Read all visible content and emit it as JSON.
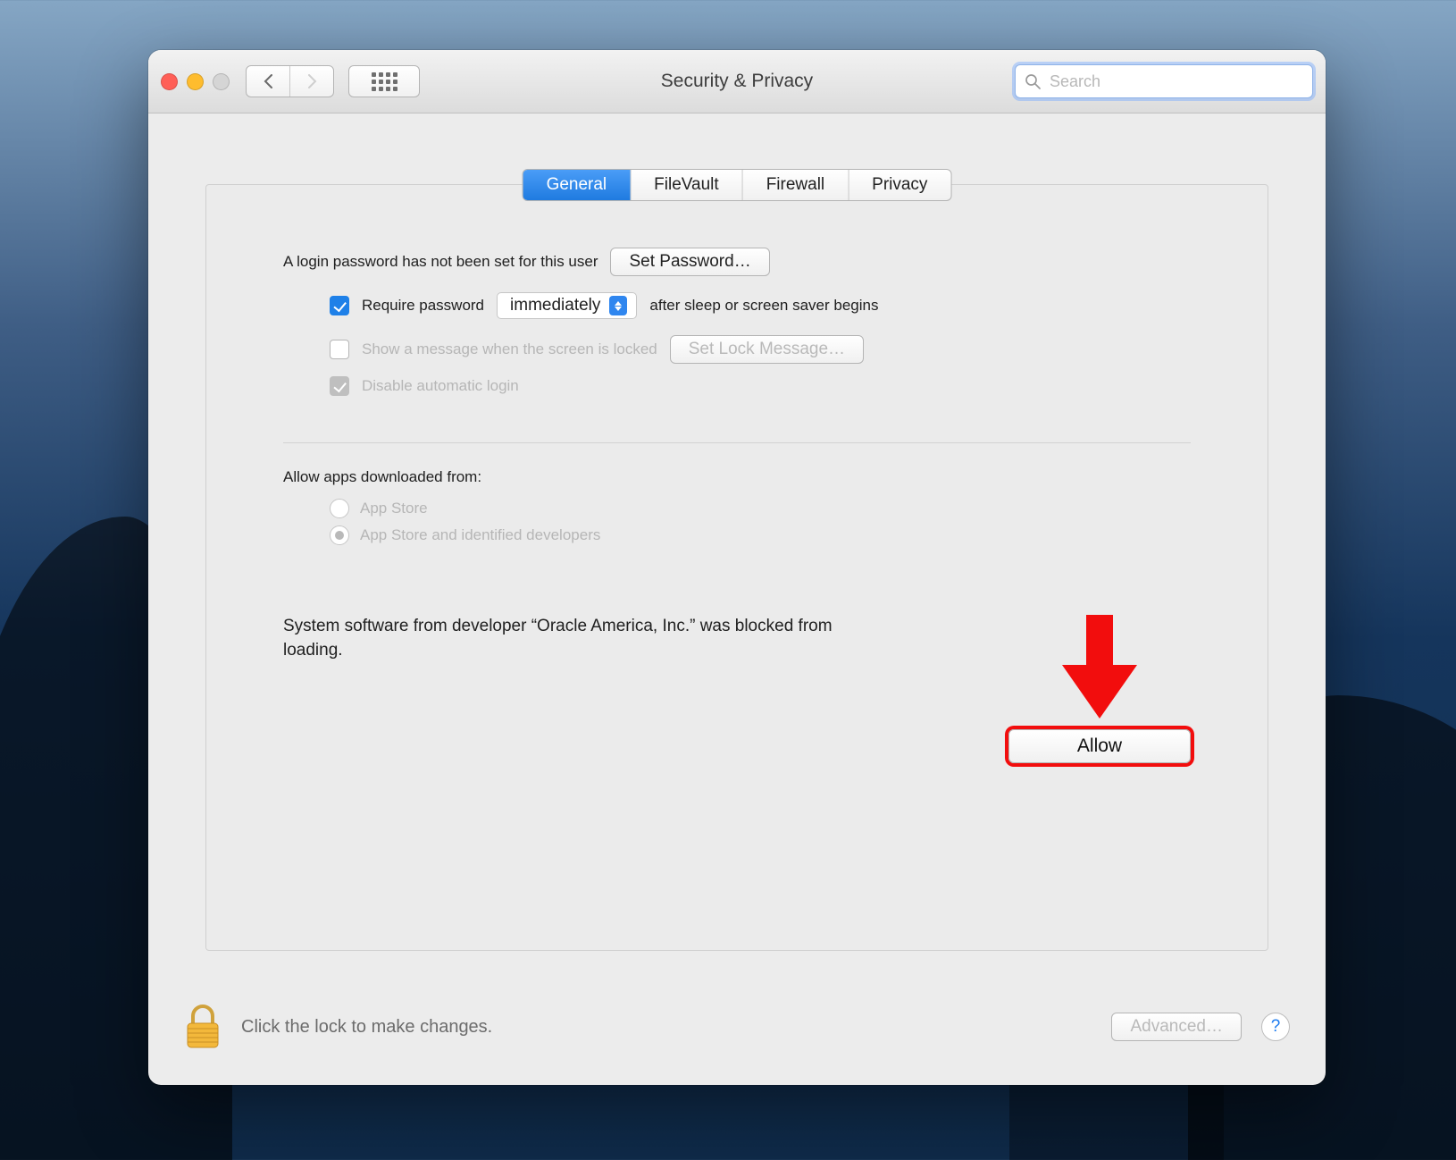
{
  "window": {
    "title": "Security & Privacy"
  },
  "search": {
    "placeholder": "Search"
  },
  "tabs": [
    "General",
    "FileVault",
    "Firewall",
    "Privacy"
  ],
  "general": {
    "login_msg": "A login password has not been set for this user",
    "set_password_btn": "Set Password…",
    "require_pw_label_left": "Require password",
    "require_pw_select": "immediately",
    "require_pw_label_right": "after sleep or screen saver begins",
    "show_msg_label": "Show a message when the screen is locked",
    "set_lock_msg_btn": "Set Lock Message…",
    "disable_auto_login": "Disable automatic login",
    "allow_header": "Allow apps downloaded from:",
    "allow_options": [
      "App Store",
      "App Store and identified developers"
    ],
    "blocked_msg": "System software from developer “Oracle America, Inc.” was blocked from loading.",
    "allow_btn": "Allow"
  },
  "footer": {
    "lock_msg": "Click the lock to make changes.",
    "advanced_btn": "Advanced…"
  }
}
